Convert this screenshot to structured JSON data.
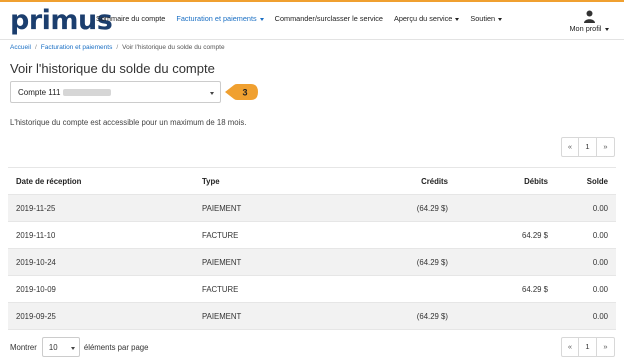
{
  "brand": {
    "logo": "primus",
    "accent": "#f0a030",
    "logo_color": "#1b3e6e",
    "link_color": "#1a6fc4"
  },
  "nav": {
    "items": [
      {
        "label": "Sommaire du compte",
        "dropdown": false,
        "active": false
      },
      {
        "label": "Facturation et paiements",
        "dropdown": true,
        "active": true
      },
      {
        "label": "Commander/surclasser le service",
        "dropdown": false,
        "active": false
      },
      {
        "label": "Aperçu du service",
        "dropdown": true,
        "active": false
      },
      {
        "label": "Soutien",
        "dropdown": true,
        "active": false
      }
    ],
    "profile_label": "Mon profil",
    "profile_icon": "user-icon"
  },
  "breadcrumb": {
    "home": "Accueil",
    "section": "Facturation et paiements",
    "current": "Voir l'historique du solde du compte"
  },
  "page_title": "Voir l'historique du solde du compte",
  "account_select": {
    "value_prefix": "Compte 111"
  },
  "callout": {
    "number": "3",
    "color": "#f0a030"
  },
  "info_text": "L'historique du compte est accessible pour un maximum de 18 mois.",
  "pagination": {
    "prev": "«",
    "page": "1",
    "next": "»"
  },
  "table": {
    "headers": {
      "date": "Date de réception",
      "type": "Type",
      "credits": "Crédits",
      "debits": "Débits",
      "balance": "Solde"
    },
    "rows": [
      {
        "date": "2019-11-25",
        "type": "PAIEMENT",
        "credits": "(64.29 $)",
        "debits": "",
        "balance": "0.00"
      },
      {
        "date": "2019-11-10",
        "type": "FACTURE",
        "credits": "",
        "debits": "64.29 $",
        "balance": "0.00"
      },
      {
        "date": "2019-10-24",
        "type": "PAIEMENT",
        "credits": "(64.29 $)",
        "debits": "",
        "balance": "0.00"
      },
      {
        "date": "2019-10-09",
        "type": "FACTURE",
        "credits": "",
        "debits": "64.29 $",
        "balance": "0.00"
      },
      {
        "date": "2019-09-25",
        "type": "PAIEMENT",
        "credits": "(64.29 $)",
        "debits": "",
        "balance": "0.00"
      }
    ]
  },
  "footer": {
    "show_label": "Montrer",
    "per_page_value": "10",
    "per_page_label": "éléments par page"
  }
}
